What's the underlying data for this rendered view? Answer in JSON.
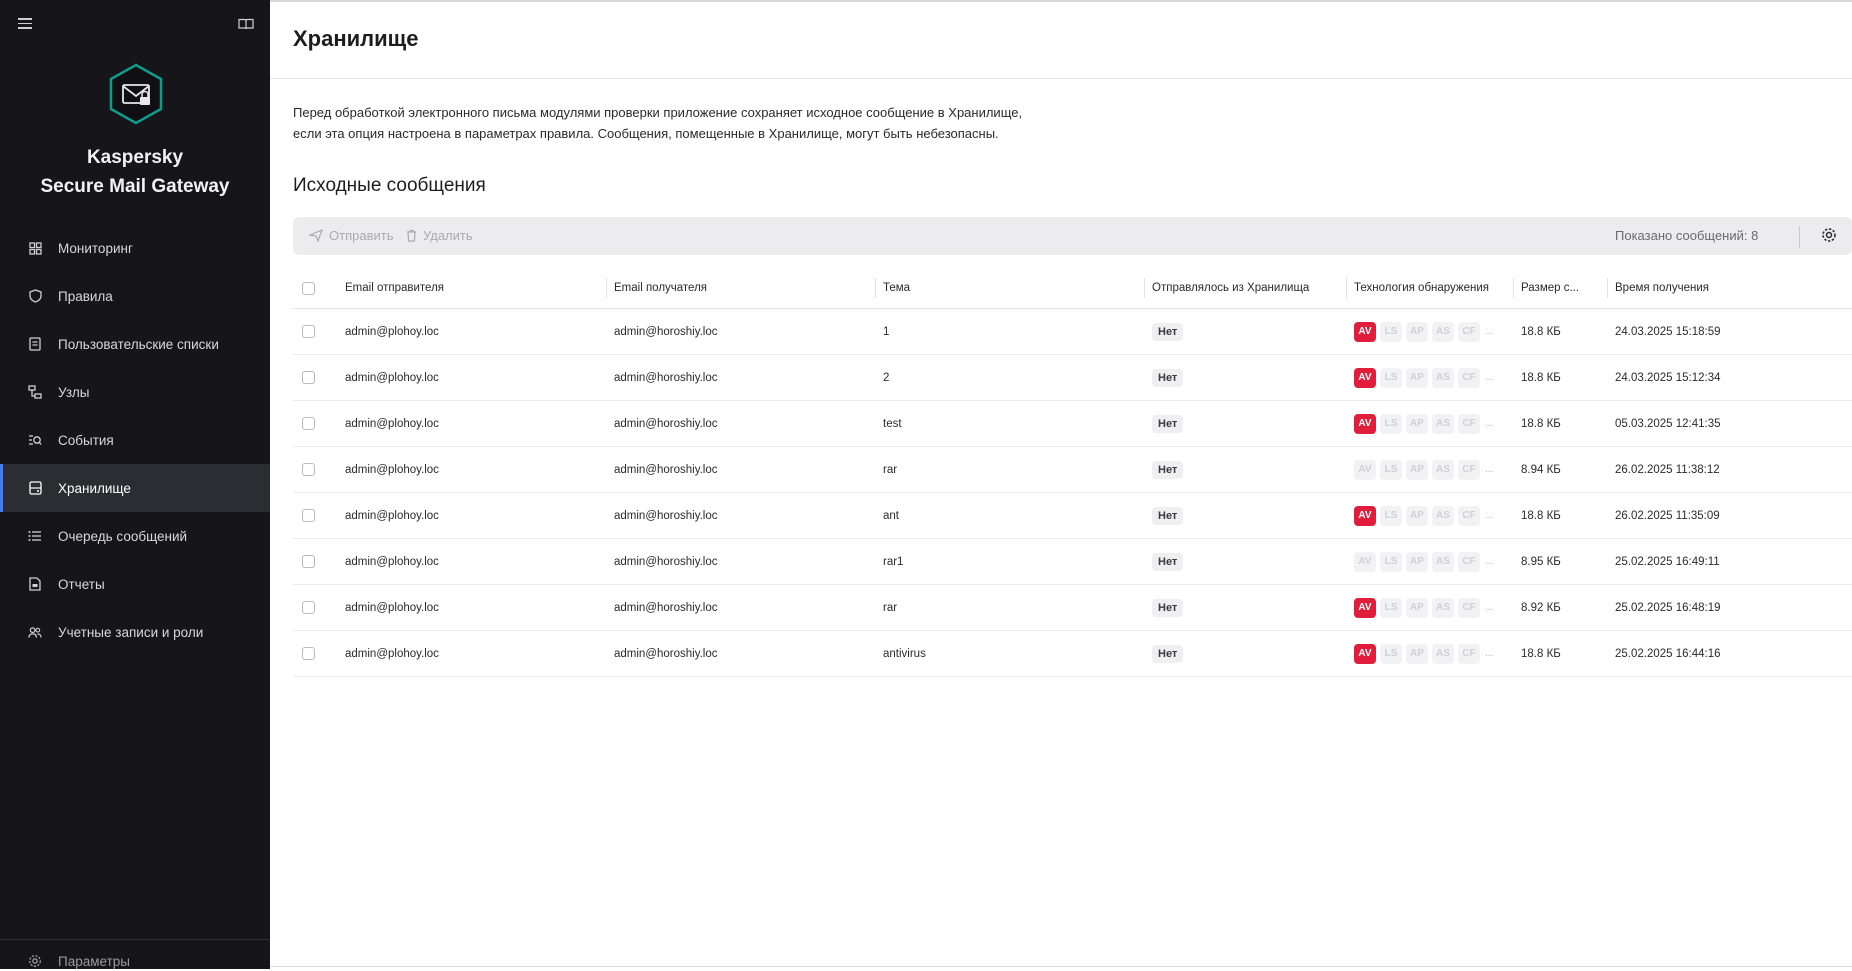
{
  "app": {
    "brand_line1": "Kaspersky",
    "brand_line2": "Secure Mail Gateway",
    "logo_icon": "envelope-lock-hexagon-icon",
    "accent_color": "#3b82f6",
    "logo_color": "#0f9d8a"
  },
  "sidebar": {
    "items": [
      {
        "label": "Мониторинг",
        "icon": "dashboard-icon",
        "active": false
      },
      {
        "label": "Правила",
        "icon": "shield-icon",
        "active": false
      },
      {
        "label": "Пользовательские списки",
        "icon": "list-document-icon",
        "active": false
      },
      {
        "label": "Узлы",
        "icon": "nodes-icon",
        "active": false
      },
      {
        "label": "События",
        "icon": "events-search-icon",
        "active": false
      },
      {
        "label": "Хранилище",
        "icon": "storage-icon",
        "active": true
      },
      {
        "label": "Очередь сообщений",
        "icon": "queue-list-icon",
        "active": false
      },
      {
        "label": "Отчеты",
        "icon": "report-icon",
        "active": false
      },
      {
        "label": "Учетные записи и роли",
        "icon": "users-icon",
        "active": false
      }
    ],
    "bottom_item": {
      "label": "Параметры",
      "icon": "gear-icon"
    }
  },
  "page": {
    "title": "Хранилище",
    "description_line1": "Перед обработкой электронного письма модулями проверки приложение сохраняет исходное сообщение в Хранилище,",
    "description_line2": "если эта опция настроена в параметрах правила. Сообщения, помещенные в Хранилище, могут быть небезопасны.",
    "section_title": "Исходные сообщения"
  },
  "toolbar": {
    "send_label": "Отправить",
    "delete_label": "Удалить",
    "count_label": "Показано сообщений: 8"
  },
  "table": {
    "columns": {
      "from": "Email отправителя",
      "to": "Email получателя",
      "subject": "Тема",
      "sent": "Отправлялось из Хранилища",
      "tech": "Технология обнаружения",
      "size": "Размер с...",
      "time": "Время получения"
    },
    "tech_labels": [
      "AV",
      "LS",
      "AP",
      "AS",
      "CF"
    ],
    "tech_more": "...",
    "tech_active_color": "#e01e3c",
    "rows": [
      {
        "from": "admin@plohoy.loc",
        "to": "admin@horoshiy.loc",
        "subject": "1",
        "sent": "Нет",
        "av_detected": true,
        "size": "18.8 КБ",
        "time": "24.03.2025 15:18:59"
      },
      {
        "from": "admin@plohoy.loc",
        "to": "admin@horoshiy.loc",
        "subject": "2",
        "sent": "Нет",
        "av_detected": true,
        "size": "18.8 КБ",
        "time": "24.03.2025 15:12:34"
      },
      {
        "from": "admin@plohoy.loc",
        "to": "admin@horoshiy.loc",
        "subject": "test",
        "sent": "Нет",
        "av_detected": true,
        "size": "18.8 КБ",
        "time": "05.03.2025 12:41:35"
      },
      {
        "from": "admin@plohoy.loc",
        "to": "admin@horoshiy.loc",
        "subject": "rar",
        "sent": "Нет",
        "av_detected": false,
        "size": "8.94 КБ",
        "time": "26.02.2025 11:38:12"
      },
      {
        "from": "admin@plohoy.loc",
        "to": "admin@horoshiy.loc",
        "subject": "ant",
        "sent": "Нет",
        "av_detected": true,
        "size": "18.8 КБ",
        "time": "26.02.2025 11:35:09"
      },
      {
        "from": "admin@plohoy.loc",
        "to": "admin@horoshiy.loc",
        "subject": "rar1",
        "sent": "Нет",
        "av_detected": false,
        "size": "8.95 КБ",
        "time": "25.02.2025 16:49:11"
      },
      {
        "from": "admin@plohoy.loc",
        "to": "admin@horoshiy.loc",
        "subject": "rar",
        "sent": "Нет",
        "av_detected": true,
        "size": "8.92 КБ",
        "time": "25.02.2025 16:48:19"
      },
      {
        "from": "admin@plohoy.loc",
        "to": "admin@horoshiy.loc",
        "subject": "antivirus",
        "sent": "Нет",
        "av_detected": true,
        "size": "18.8 КБ",
        "time": "25.02.2025 16:44:16"
      }
    ]
  }
}
